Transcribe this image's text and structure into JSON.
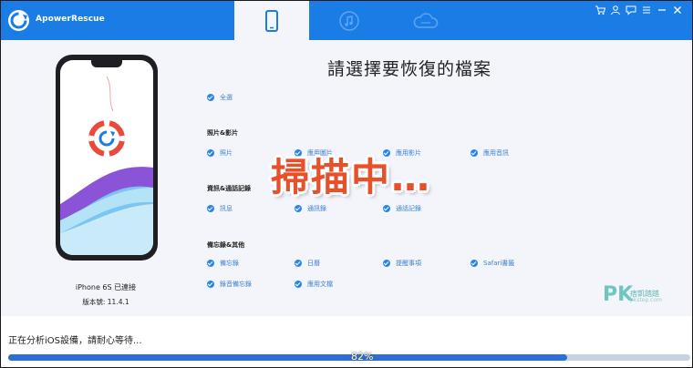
{
  "app": {
    "title": "ApowerRescue"
  },
  "tabs": [
    {
      "icon": "phone-icon",
      "active": true
    },
    {
      "icon": "itunes-music-icon",
      "active": false
    },
    {
      "icon": "icloud-icon",
      "active": false
    }
  ],
  "window_controls": [
    "cart-icon",
    "user-icon",
    "feedback-icon",
    "menu-icon",
    "minimize-icon",
    "close-icon"
  ],
  "device": {
    "name": "iPhone 6S 已連接",
    "version": "版本號: 11.4.1"
  },
  "heading": "請選擇要恢復的檔案",
  "select_all": "全選",
  "sections": {
    "media": {
      "title": "照片&影片",
      "items": [
        "照片",
        "應用圖片",
        "應用影片",
        "應用音訊"
      ]
    },
    "messages": {
      "title": "資訊&通話記錄",
      "items": [
        "訊息",
        "通訊錄",
        "通話記錄"
      ]
    },
    "memos": {
      "title": "備忘錄&其他",
      "items": [
        "備忘錄",
        "日曆",
        "提醒事項",
        "Safari書籤",
        "錄音備忘錄",
        "應用文檔"
      ]
    }
  },
  "overlay": {
    "scanning": "掃描中…"
  },
  "watermark": {
    "logo": "PK",
    "text": "痞凱踏踏",
    "sub": "pkstep.com"
  },
  "status": {
    "message": "正在分析iOS設備，請耐心等待...",
    "progress_label": "82%",
    "progress": 0.82
  },
  "colors": {
    "accent": "#1a7de6",
    "progress": "#2b6fd6",
    "scanning": "#e8502b"
  }
}
